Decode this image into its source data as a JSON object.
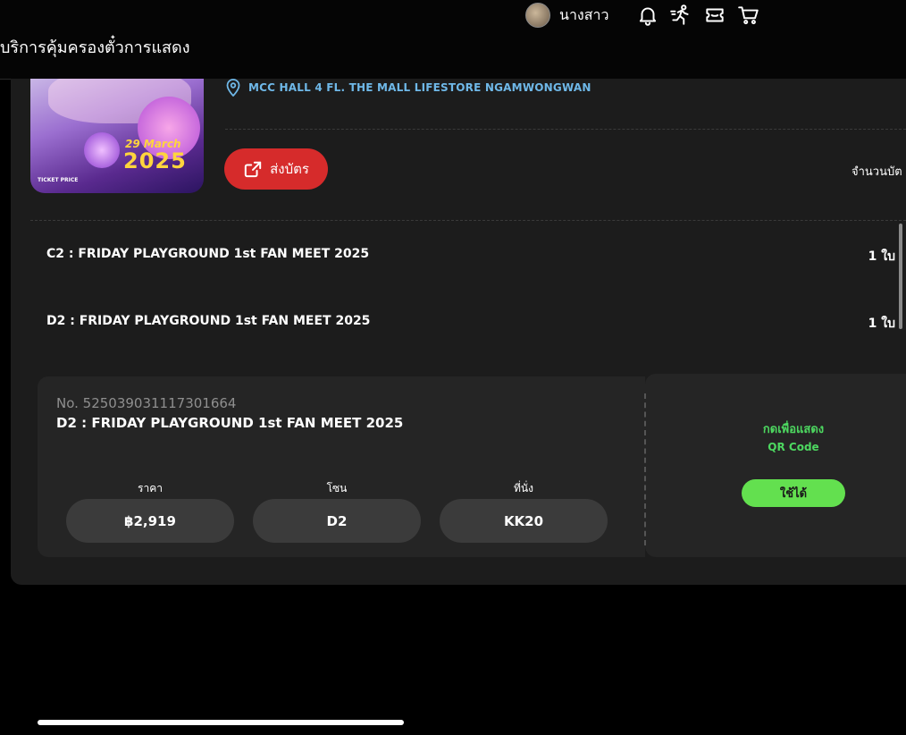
{
  "header": {
    "page_title": "บริการคุ้มครองตั๋วการแสดง",
    "username": "นางสาว",
    "icons": [
      "bell-icon",
      "runner-icon",
      "ticket-icon",
      "cart-icon"
    ]
  },
  "event": {
    "location": "MCC HALL 4 FL. THE MALL LIFESTORE NGAMWONGWAN",
    "poster": {
      "date_text": "29 March",
      "year_text": "2025",
      "price_text": "TICKET PRICE"
    },
    "share_label": "ส่งบัตร",
    "count_label": "จำนวนบัต"
  },
  "tickets": [
    {
      "name": "C2 : FRIDAY PLAYGROUND 1st FAN MEET 2025",
      "qty": "1 ใบ"
    },
    {
      "name": "D2 : FRIDAY PLAYGROUND 1st FAN MEET 2025",
      "qty": "1 ใบ"
    }
  ],
  "ticket_card": {
    "number": "No. 525039031117301664",
    "title": "D2 : FRIDAY PLAYGROUND 1st FAN MEET 2025",
    "price_label": "ราคา",
    "price_value": "฿2,919",
    "zone_label": "โซน",
    "zone_value": "D2",
    "seat_label": "ที่นั่ง",
    "seat_value": "KK20",
    "qr_prompt": "กดเพื่อแสดง",
    "qr_sub": "QR Code",
    "status_label": "ใช้ได้"
  },
  "colors": {
    "accent_red": "#d62b2b",
    "status_green": "#63e04f",
    "location_blue": "#6fb8e8"
  }
}
